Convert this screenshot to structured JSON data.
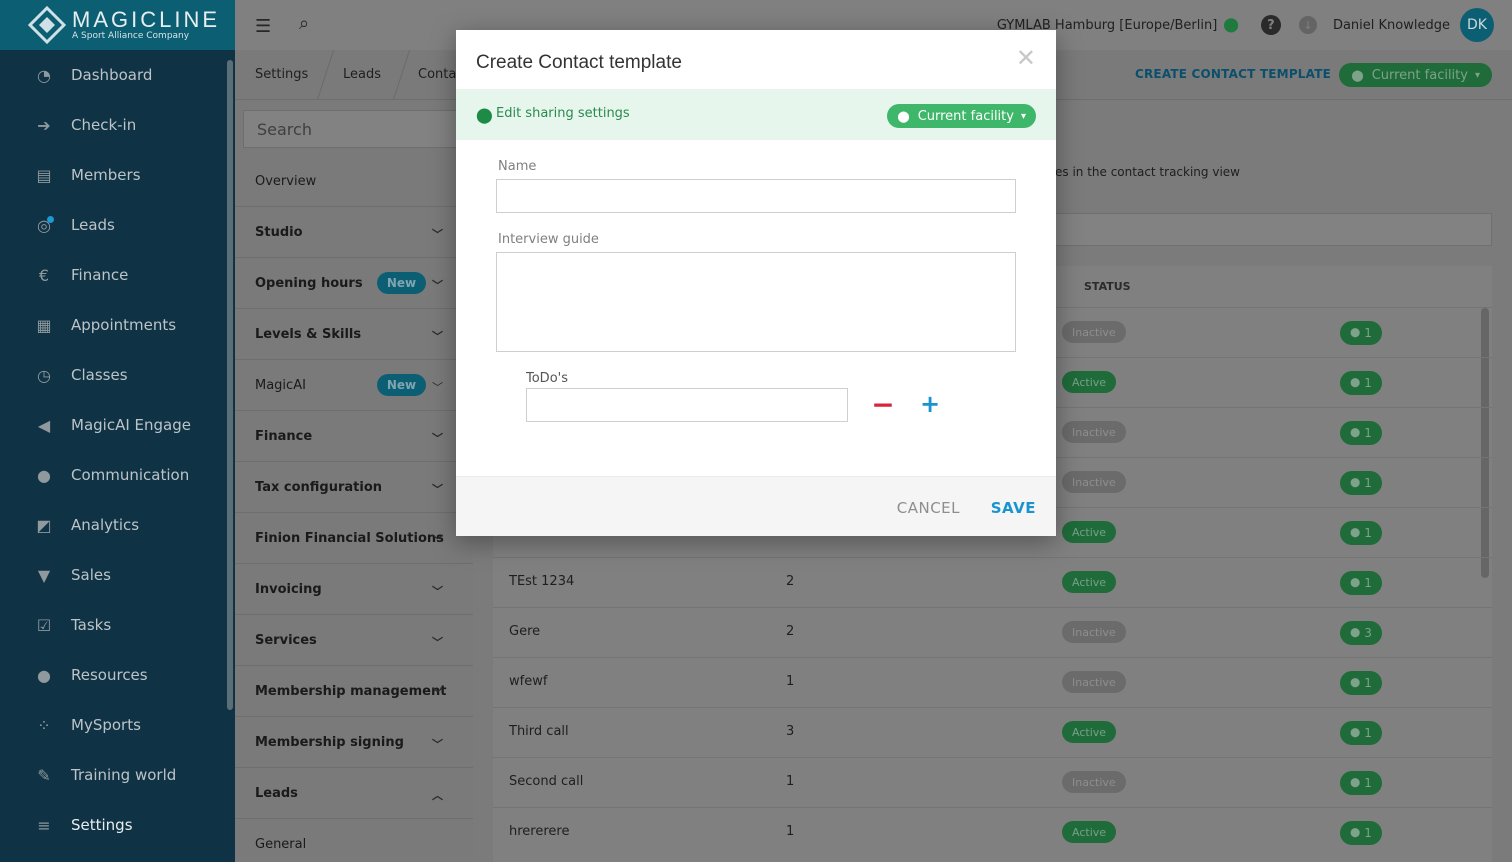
{
  "logo": {
    "brand": "MAGICLINE",
    "tagline": "A Sport Alliance Company"
  },
  "sidebar": {
    "items": [
      {
        "label": "Dashboard",
        "icon": "dashboard-icon",
        "glyph": "◔"
      },
      {
        "label": "Check-in",
        "icon": "checkin-icon",
        "glyph": "➔"
      },
      {
        "label": "Members",
        "icon": "members-icon",
        "glyph": "▤"
      },
      {
        "label": "Leads",
        "icon": "leads-icon",
        "glyph": "◎"
      },
      {
        "label": "Finance",
        "icon": "finance-icon",
        "glyph": "€"
      },
      {
        "label": "Appointments",
        "icon": "calendar-icon",
        "glyph": "▦"
      },
      {
        "label": "Classes",
        "icon": "stopwatch-icon",
        "glyph": "◷"
      },
      {
        "label": "MagicAI Engage",
        "icon": "megaphone-icon",
        "glyph": "◀"
      },
      {
        "label": "Communication",
        "icon": "chat-icon",
        "glyph": "●"
      },
      {
        "label": "Analytics",
        "icon": "chart-icon",
        "glyph": "◩"
      },
      {
        "label": "Sales",
        "icon": "cart-icon",
        "glyph": "▼"
      },
      {
        "label": "Tasks",
        "icon": "checkbox-icon",
        "glyph": "☑"
      },
      {
        "label": "Resources",
        "icon": "people-icon",
        "glyph": "●"
      },
      {
        "label": "MySports",
        "icon": "dots-grid-icon",
        "glyph": "⁘"
      },
      {
        "label": "Training world",
        "icon": "dumbbell-icon",
        "glyph": "✎"
      },
      {
        "label": "Settings",
        "icon": "sliders-icon",
        "glyph": "≡"
      }
    ]
  },
  "topbar": {
    "facility": "GYMLAB Hamburg [Europe/Berlin]",
    "user": "Daniel Knowledge",
    "initials": "DK"
  },
  "breadcrumb": [
    "Settings",
    "Leads",
    "Contac"
  ],
  "subnav": {
    "create_label": "CREATE CONTACT TEMPLATE",
    "facility_label": "Current facility"
  },
  "settings_panel": {
    "search_placeholder": "Search",
    "items": [
      {
        "label": "Overview",
        "bold": false,
        "chevron": "",
        "badge": ""
      },
      {
        "label": "Studio",
        "bold": true,
        "chevron": "down",
        "badge": ""
      },
      {
        "label": "Opening hours",
        "bold": true,
        "chevron": "down",
        "badge": "New"
      },
      {
        "label": "Levels & Skills",
        "bold": true,
        "chevron": "down",
        "badge": ""
      },
      {
        "label": "MagicAI",
        "bold": false,
        "chevron": "down",
        "badge": "New"
      },
      {
        "label": "Finance",
        "bold": true,
        "chevron": "down",
        "badge": ""
      },
      {
        "label": "Tax configuration",
        "bold": true,
        "chevron": "down",
        "badge": ""
      },
      {
        "label": "Finion Financial Solutions",
        "bold": true,
        "chevron": "down",
        "badge": ""
      },
      {
        "label": "Invoicing",
        "bold": true,
        "chevron": "down",
        "badge": ""
      },
      {
        "label": "Services",
        "bold": true,
        "chevron": "down",
        "badge": ""
      },
      {
        "label": "Membership management",
        "bold": true,
        "chevron": "down",
        "badge": ""
      },
      {
        "label": "Membership signing",
        "bold": true,
        "chevron": "down",
        "badge": ""
      },
      {
        "label": "Leads",
        "bold": true,
        "chevron": "up",
        "badge": ""
      },
      {
        "label": "General",
        "bold": false,
        "chevron": "",
        "badge": ""
      }
    ]
  },
  "content": {
    "description_fragment": "es in the contact tracking view",
    "status_header": "STATUS",
    "rows": [
      {
        "name": "",
        "count": "",
        "status": "Inactive",
        "facilities": "1"
      },
      {
        "name": "",
        "count": "",
        "status": "Active",
        "facilities": "1"
      },
      {
        "name": "",
        "count": "",
        "status": "Inactive",
        "facilities": "1"
      },
      {
        "name": "",
        "count": "",
        "status": "Inactive",
        "facilities": "1"
      },
      {
        "name": "",
        "count": "",
        "status": "Active",
        "facilities": "1"
      },
      {
        "name": "TEst 1234",
        "count": "2",
        "status": "Active",
        "facilities": "1"
      },
      {
        "name": "Gere",
        "count": "2",
        "status": "Inactive",
        "facilities": "3"
      },
      {
        "name": "wfewf",
        "count": "1",
        "status": "Inactive",
        "facilities": "1"
      },
      {
        "name": "Third call",
        "count": "3",
        "status": "Active",
        "facilities": "1"
      },
      {
        "name": "Second call",
        "count": "1",
        "status": "Inactive",
        "facilities": "1"
      },
      {
        "name": "hrererere",
        "count": "1",
        "status": "Active",
        "facilities": "1"
      }
    ]
  },
  "modal": {
    "title": "Create Contact template",
    "sharing_label": "Edit sharing settings",
    "facility_label": "Current facility",
    "name_label": "Name",
    "name_value": "",
    "guide_label": "Interview guide",
    "guide_value": "",
    "todo_label": "ToDo's",
    "todo_value": "",
    "cancel_label": "CANCEL",
    "save_label": "SAVE"
  },
  "colors": {
    "brand": "#0c5f73",
    "accent_blue": "#1a94cf",
    "success": "#3fb76a",
    "danger": "#d8243f"
  }
}
